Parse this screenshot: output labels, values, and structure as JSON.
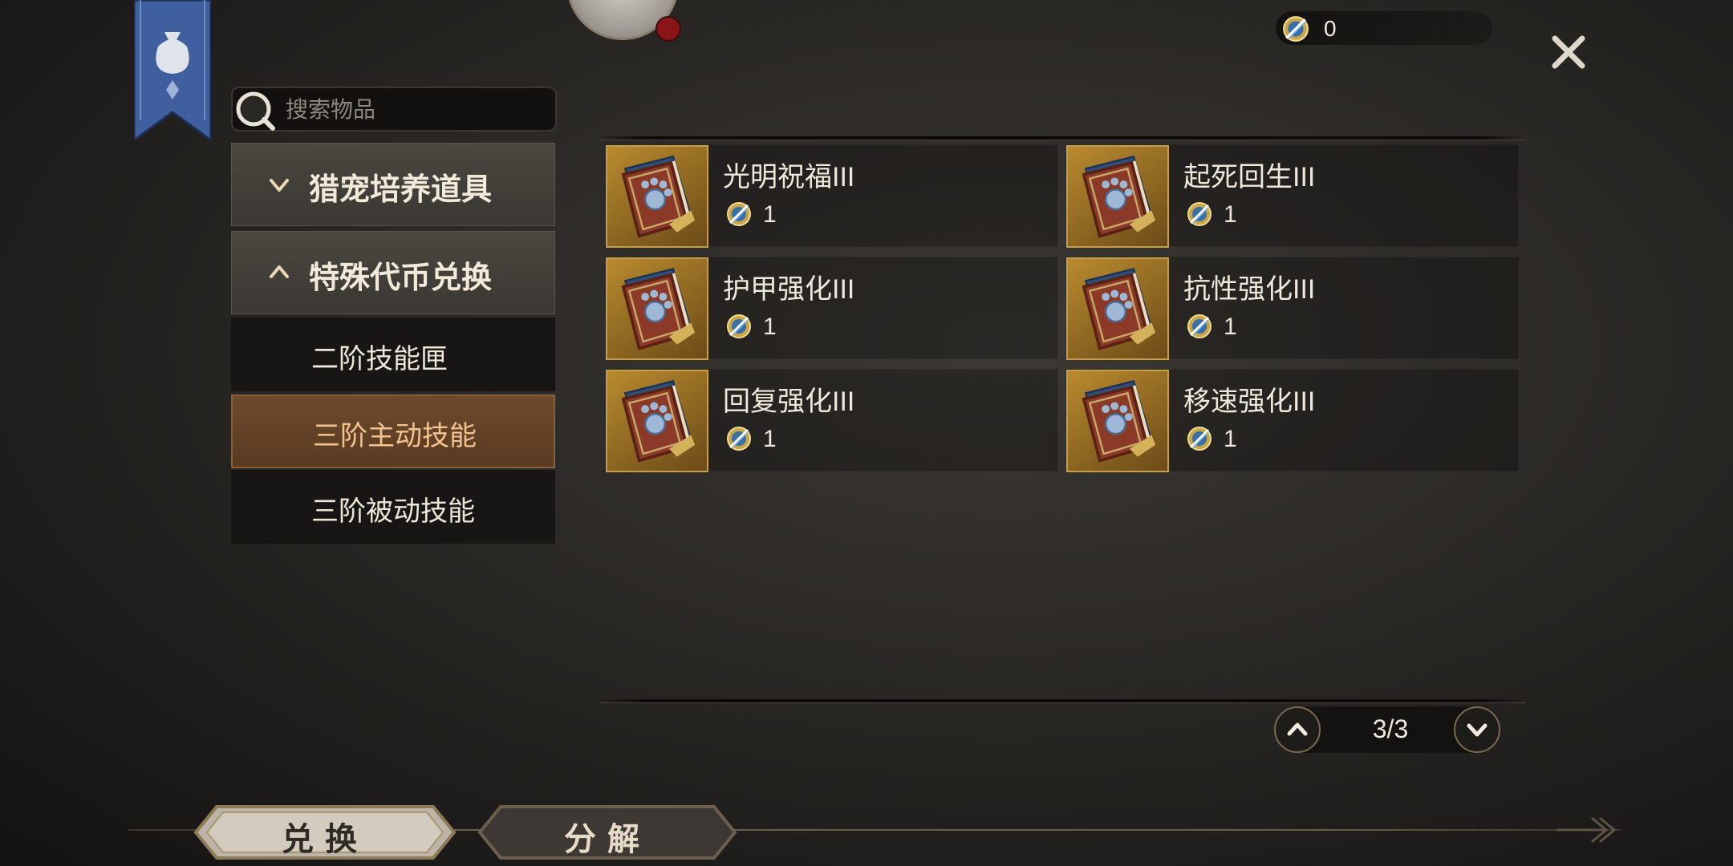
{
  "currency": {
    "value": "0"
  },
  "search": {
    "placeholder": "搜索物品"
  },
  "sidebar": {
    "categories": [
      {
        "label": "猎宠培养道具",
        "expanded": false
      },
      {
        "label": "特殊代币兑换",
        "expanded": true
      }
    ],
    "subitems": [
      {
        "label": "二阶技能匣",
        "active": false
      },
      {
        "label": "三阶主动技能",
        "active": true
      },
      {
        "label": "三阶被动技能",
        "active": false
      }
    ]
  },
  "items": [
    {
      "name": "光明祝福III",
      "price": "1"
    },
    {
      "name": "起死回生III",
      "price": "1"
    },
    {
      "name": "护甲强化III",
      "price": "1"
    },
    {
      "name": "抗性强化III",
      "price": "1"
    },
    {
      "name": "回复强化III",
      "price": "1"
    },
    {
      "name": "移速强化III",
      "price": "1"
    }
  ],
  "pager": {
    "label": "3/3"
  },
  "tabs": {
    "exchange": "兑换",
    "decompose": "分解"
  },
  "colors": {
    "accent_active": "#f1c48f",
    "active_bg": "#6e4a2c",
    "card_icon_bg": "#b98b2f",
    "banner": "#3f5f9e"
  }
}
